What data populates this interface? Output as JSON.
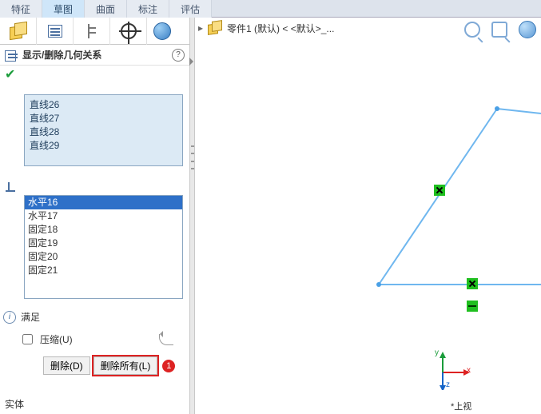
{
  "tabs": {
    "t0": "特征",
    "t1": "草图",
    "t2": "曲面",
    "t3": "标注",
    "t4": "评估",
    "activeIndex": 1
  },
  "panel": {
    "title": "显示/删除几何关系",
    "ok_tip": "确定"
  },
  "entities": [
    "直线26",
    "直线27",
    "直线28",
    "直线29"
  ],
  "relations": [
    "水平16",
    "水平17",
    "固定18",
    "固定19",
    "固定20",
    "固定21"
  ],
  "relations_selected": 0,
  "status": {
    "label": "满足"
  },
  "suppress": {
    "label": "压缩(U)"
  },
  "buttons": {
    "delete": "删除(D)",
    "delete_all": "删除所有(L)"
  },
  "callout": "1",
  "footer": {
    "entity": "实体"
  },
  "doc": {
    "title": "零件1 (默认) < <默认>_..."
  },
  "origin": {
    "x": "x",
    "y": "y",
    "z": "z"
  },
  "viewname": "*上视",
  "toolicons": {
    "zoomfit": "zoom-fit",
    "zoomwin": "zoom-window",
    "view": "view-orientation"
  }
}
